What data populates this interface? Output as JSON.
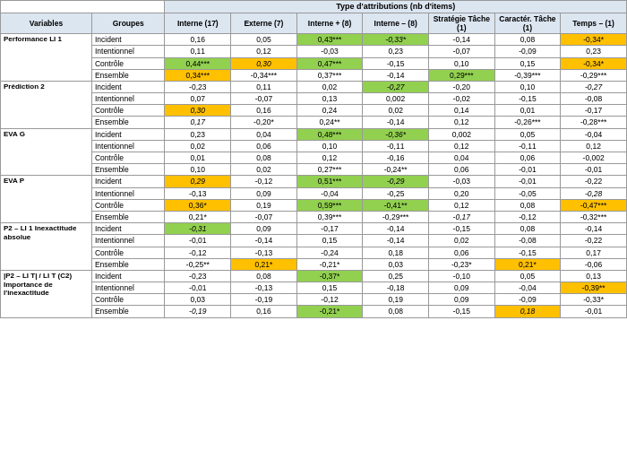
{
  "title": "Type d'attributions (nb d'items)",
  "headers": {
    "variables": "Variables",
    "groupes": "Groupes",
    "interne17": "Interne (17)",
    "externe7": "Externe (7)",
    "interne8": "Interne + (8)",
    "interne_minus8": "Interne – (8)",
    "strategie1": "Stratégie Tâche (1)",
    "caractere1": "Caractér. Tâche (1)",
    "temps1": "Temps – (1)"
  },
  "sections": [
    {
      "label": "Performance LI 1",
      "rows": [
        {
          "groupe": "Incident",
          "v1": "0,16",
          "v1_style": "",
          "v2": "0,05",
          "v2_style": "",
          "v3": "0,43***",
          "v3_style": "bg-green",
          "v4": "-0,33*",
          "v4_style": "bg-green italic",
          "v5": "-0,14",
          "v5_style": "",
          "v6": "0,08",
          "v6_style": "",
          "v7": "-0,34*",
          "v7_style": "bg-orange"
        },
        {
          "groupe": "Intentionnel",
          "v1": "0,11",
          "v1_style": "",
          "v2": "0,12",
          "v2_style": "",
          "v3": "-0,03",
          "v3_style": "",
          "v4": "0,23",
          "v4_style": "",
          "v5": "-0,07",
          "v5_style": "",
          "v6": "-0,09",
          "v6_style": "",
          "v7": "0,23",
          "v7_style": ""
        },
        {
          "groupe": "Contrôle",
          "v1": "0,44***",
          "v1_style": "bg-green",
          "v2": "0,30",
          "v2_style": "bg-orange italic",
          "v3": "0,47***",
          "v3_style": "bg-green",
          "v4": "-0,15",
          "v4_style": "",
          "v5": "0,10",
          "v5_style": "",
          "v6": "0,15",
          "v6_style": "",
          "v7": "-0,34*",
          "v7_style": "bg-orange"
        },
        {
          "groupe": "Ensemble",
          "v1": "0,34***",
          "v1_style": "bg-orange",
          "v2": "-0,34***",
          "v2_style": "",
          "v3": "0,37***",
          "v3_style": "",
          "v4": "-0,14",
          "v4_style": "",
          "v5": "0,29***",
          "v5_style": "bg-green",
          "v6": "-0,39***",
          "v6_style": "",
          "v7": "-0,29***",
          "v7_style": ""
        }
      ]
    },
    {
      "label": "Prédiction 2",
      "rows": [
        {
          "groupe": "Incident",
          "v1": "-0,23",
          "v1_style": "",
          "v2": "0,11",
          "v2_style": "",
          "v3": "0,02",
          "v3_style": "",
          "v4": "-0,27",
          "v4_style": "bg-green italic",
          "v5": "-0,20",
          "v5_style": "",
          "v6": "0,10",
          "v6_style": "",
          "v7": "-0,27",
          "v7_style": "italic"
        },
        {
          "groupe": "Intentionnel",
          "v1": "0,07",
          "v1_style": "",
          "v2": "-0,07",
          "v2_style": "",
          "v3": "0,13",
          "v3_style": "",
          "v4": "0,002",
          "v4_style": "",
          "v5": "-0,02",
          "v5_style": "",
          "v6": "-0,15",
          "v6_style": "",
          "v7": "-0,08",
          "v7_style": ""
        },
        {
          "groupe": "Contrôle",
          "v1": "0,30",
          "v1_style": "bg-orange italic",
          "v2": "0,16",
          "v2_style": "",
          "v3": "0,24",
          "v3_style": "",
          "v4": "0,02",
          "v4_style": "",
          "v5": "0,14",
          "v5_style": "",
          "v6": "0,01",
          "v6_style": "",
          "v7": "-0,17",
          "v7_style": ""
        },
        {
          "groupe": "Ensemble",
          "v1": "0,17",
          "v1_style": "italic",
          "v2": "-0,20*",
          "v2_style": "",
          "v3": "0,24**",
          "v3_style": "",
          "v4": "-0,14",
          "v4_style": "",
          "v5": "0,12",
          "v5_style": "",
          "v6": "-0,26***",
          "v6_style": "",
          "v7": "-0,28***",
          "v7_style": ""
        }
      ]
    },
    {
      "label": "EVA G",
      "rows": [
        {
          "groupe": "Incident",
          "v1": "0,23",
          "v1_style": "",
          "v2": "0,04",
          "v2_style": "",
          "v3": "0,48***",
          "v3_style": "bg-green",
          "v4": "-0,36*",
          "v4_style": "bg-green italic",
          "v5": "0,002",
          "v5_style": "",
          "v6": "0,05",
          "v6_style": "",
          "v7": "-0,04",
          "v7_style": ""
        },
        {
          "groupe": "Intentionnel",
          "v1": "0,02",
          "v1_style": "",
          "v2": "0,06",
          "v2_style": "",
          "v3": "0,10",
          "v3_style": "",
          "v4": "-0,11",
          "v4_style": "",
          "v5": "0,12",
          "v5_style": "",
          "v6": "-0,11",
          "v6_style": "",
          "v7": "0,12",
          "v7_style": ""
        },
        {
          "groupe": "Contrôle",
          "v1": "0,01",
          "v1_style": "",
          "v2": "0,08",
          "v2_style": "",
          "v3": "0,12",
          "v3_style": "",
          "v4": "-0,16",
          "v4_style": "",
          "v5": "0,04",
          "v5_style": "",
          "v6": "0,06",
          "v6_style": "",
          "v7": "-0,002",
          "v7_style": ""
        },
        {
          "groupe": "Ensemble",
          "v1": "0,10",
          "v1_style": "",
          "v2": "0,02",
          "v2_style": "",
          "v3": "0,27***",
          "v3_style": "",
          "v4": "-0,24**",
          "v4_style": "",
          "v5": "0,06",
          "v5_style": "",
          "v6": "-0,01",
          "v6_style": "",
          "v7": "-0,01",
          "v7_style": ""
        }
      ]
    },
    {
      "label": "EVA P",
      "rows": [
        {
          "groupe": "Incident",
          "v1": "0,29",
          "v1_style": "bg-orange italic",
          "v2": "-0,12",
          "v2_style": "",
          "v3": "0,51***",
          "v3_style": "bg-green",
          "v4": "-0,29",
          "v4_style": "bg-green italic",
          "v5": "-0,03",
          "v5_style": "",
          "v6": "-0,01",
          "v6_style": "",
          "v7": "-0,22",
          "v7_style": ""
        },
        {
          "groupe": "Intentionnel",
          "v1": "-0,13",
          "v1_style": "",
          "v2": "0,09",
          "v2_style": "",
          "v3": "-0,04",
          "v3_style": "",
          "v4": "-0,25",
          "v4_style": "",
          "v5": "0,20",
          "v5_style": "",
          "v6": "-0,05",
          "v6_style": "",
          "v7": "-0,28",
          "v7_style": "italic"
        },
        {
          "groupe": "Contrôle",
          "v1": "0,36*",
          "v1_style": "bg-orange",
          "v2": "0,19",
          "v2_style": "",
          "v3": "0,59***",
          "v3_style": "bg-green",
          "v4": "-0,41**",
          "v4_style": "bg-green",
          "v5": "0,12",
          "v5_style": "",
          "v6": "0,08",
          "v6_style": "",
          "v7": "-0,47***",
          "v7_style": "bg-orange"
        },
        {
          "groupe": "Ensemble",
          "v1": "0,21*",
          "v1_style": "",
          "v2": "-0,07",
          "v2_style": "",
          "v3": "0,39***",
          "v3_style": "",
          "v4": "-0,29***",
          "v4_style": "",
          "v5": "-0,17",
          "v5_style": "italic",
          "v6": "-0,12",
          "v6_style": "",
          "v7": "-0,32***",
          "v7_style": ""
        }
      ]
    },
    {
      "label": "P2 – LI 1 Inexactitude absolue",
      "rows": [
        {
          "groupe": "Incident",
          "v1": "-0,31",
          "v1_style": "bg-green italic",
          "v2": "0,09",
          "v2_style": "",
          "v3": "-0,17",
          "v3_style": "",
          "v4": "-0,14",
          "v4_style": "",
          "v5": "-0,15",
          "v5_style": "",
          "v6": "0,08",
          "v6_style": "",
          "v7": "-0,14",
          "v7_style": ""
        },
        {
          "groupe": "Intentionnel",
          "v1": "-0,01",
          "v1_style": "",
          "v2": "-0,14",
          "v2_style": "",
          "v3": "0,15",
          "v3_style": "",
          "v4": "-0,14",
          "v4_style": "",
          "v5": "0,02",
          "v5_style": "",
          "v6": "-0,08",
          "v6_style": "",
          "v7": "-0,22",
          "v7_style": ""
        },
        {
          "groupe": "Contrôle",
          "v1": "-0,12",
          "v1_style": "",
          "v2": "-0,13",
          "v2_style": "",
          "v3": "-0,24",
          "v3_style": "",
          "v4": "0,18",
          "v4_style": "",
          "v5": "0,06",
          "v5_style": "",
          "v6": "-0,15",
          "v6_style": "",
          "v7": "0,17",
          "v7_style": ""
        },
        {
          "groupe": "Ensemble",
          "v1": "-0,25**",
          "v1_style": "",
          "v2": "0,21*",
          "v2_style": "bg-orange",
          "v3": "-0,21*",
          "v3_style": "",
          "v4": "0,03",
          "v4_style": "",
          "v5": "-0,23*",
          "v5_style": "",
          "v6": "0,21*",
          "v6_style": "bg-orange",
          "v7": "-0,06",
          "v7_style": ""
        }
      ]
    },
    {
      "label": "|P2 – LI T| / LI T (C2) Importance de l'inexactitude",
      "rows": [
        {
          "groupe": "Incident",
          "v1": "-0,23",
          "v1_style": "",
          "v2": "0,08",
          "v2_style": "",
          "v3": "-0,37*",
          "v3_style": "bg-green",
          "v4": "0,25",
          "v4_style": "",
          "v5": "-0,10",
          "v5_style": "",
          "v6": "0,05",
          "v6_style": "",
          "v7": "0,13",
          "v7_style": ""
        },
        {
          "groupe": "Intentionnel",
          "v1": "-0,01",
          "v1_style": "",
          "v2": "-0,13",
          "v2_style": "",
          "v3": "0,15",
          "v3_style": "",
          "v4": "-0,18",
          "v4_style": "",
          "v5": "0,09",
          "v5_style": "",
          "v6": "-0,04",
          "v6_style": "",
          "v7": "-0,39**",
          "v7_style": "bg-orange"
        },
        {
          "groupe": "Contrôle",
          "v1": "0,03",
          "v1_style": "",
          "v2": "-0,19",
          "v2_style": "",
          "v3": "-0,12",
          "v3_style": "",
          "v4": "0,19",
          "v4_style": "",
          "v5": "0,09",
          "v5_style": "",
          "v6": "-0,09",
          "v6_style": "",
          "v7": "-0,33*",
          "v7_style": ""
        },
        {
          "groupe": "Ensemble",
          "v1": "-0,19",
          "v1_style": "italic",
          "v2": "0,16",
          "v2_style": "",
          "v3": "-0,21*",
          "v3_style": "bg-green",
          "v4": "0,08",
          "v4_style": "",
          "v5": "-0,15",
          "v5_style": "",
          "v6": "0,18",
          "v6_style": "bg-orange italic",
          "v7": "-0,01",
          "v7_style": ""
        }
      ]
    }
  ]
}
